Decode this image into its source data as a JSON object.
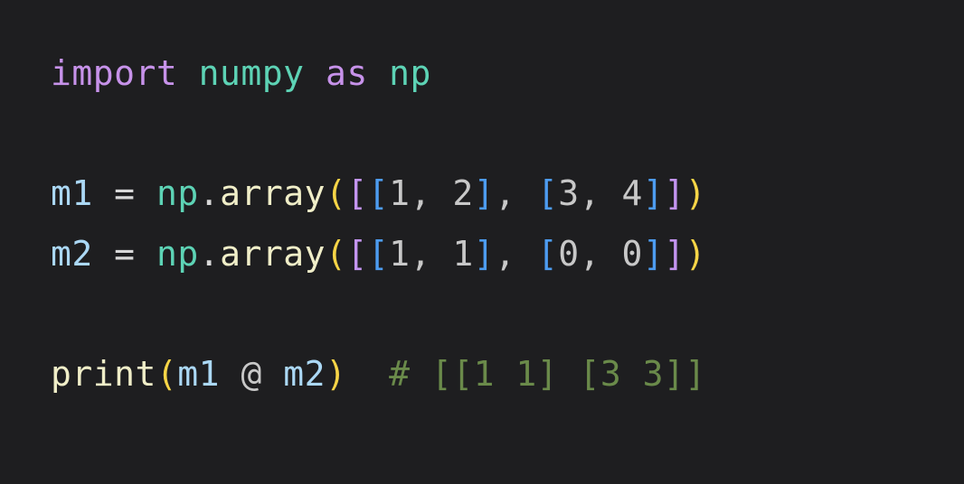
{
  "line1": {
    "import": "import",
    "module": "numpy",
    "as": "as",
    "alias": "np"
  },
  "line3": {
    "var": "m1",
    "eq": "=",
    "obj": "np",
    "dot": ".",
    "fn": "array",
    "n1": "1",
    "n2": "2",
    "n3": "3",
    "n4": "4"
  },
  "line4": {
    "var": "m2",
    "eq": "=",
    "obj": "np",
    "dot": ".",
    "fn": "array",
    "n1": "1",
    "n2": "1",
    "n3": "0",
    "n4": "0"
  },
  "line6": {
    "fn": "print",
    "arg1": "m1",
    "op": "@",
    "arg2": "m2",
    "comment": "# [[1 1] [3 3]]"
  },
  "glyphs": {
    "lparen": "(",
    "rparen": ")",
    "lbrack": "[",
    "rbrack": "]",
    "comma": ",",
    "space": " "
  }
}
